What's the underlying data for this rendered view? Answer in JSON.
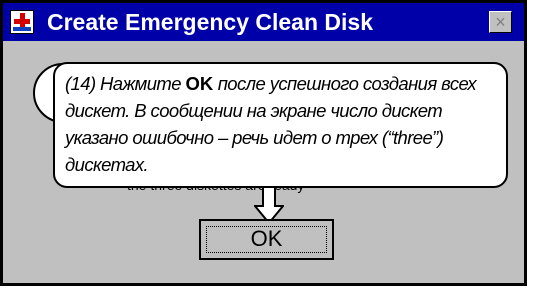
{
  "window": {
    "title": "Create Emergency Clean Disk",
    "close_glyph": "×"
  },
  "background_text": "the three diskettes are ready",
  "ok_button": {
    "label": "OK"
  },
  "callout": {
    "step": "(14)",
    "before": " Нажмите ",
    "bold": "OK",
    "after": " после успешного создания всех дискет. В сообщении на экране число дискет указано ошибочно – речь идет о трех (“three”) дискетах."
  },
  "icons": {
    "app": "first-aid-disk-icon",
    "dialog": "information-icon",
    "pointer": "down-arrow-icon"
  }
}
